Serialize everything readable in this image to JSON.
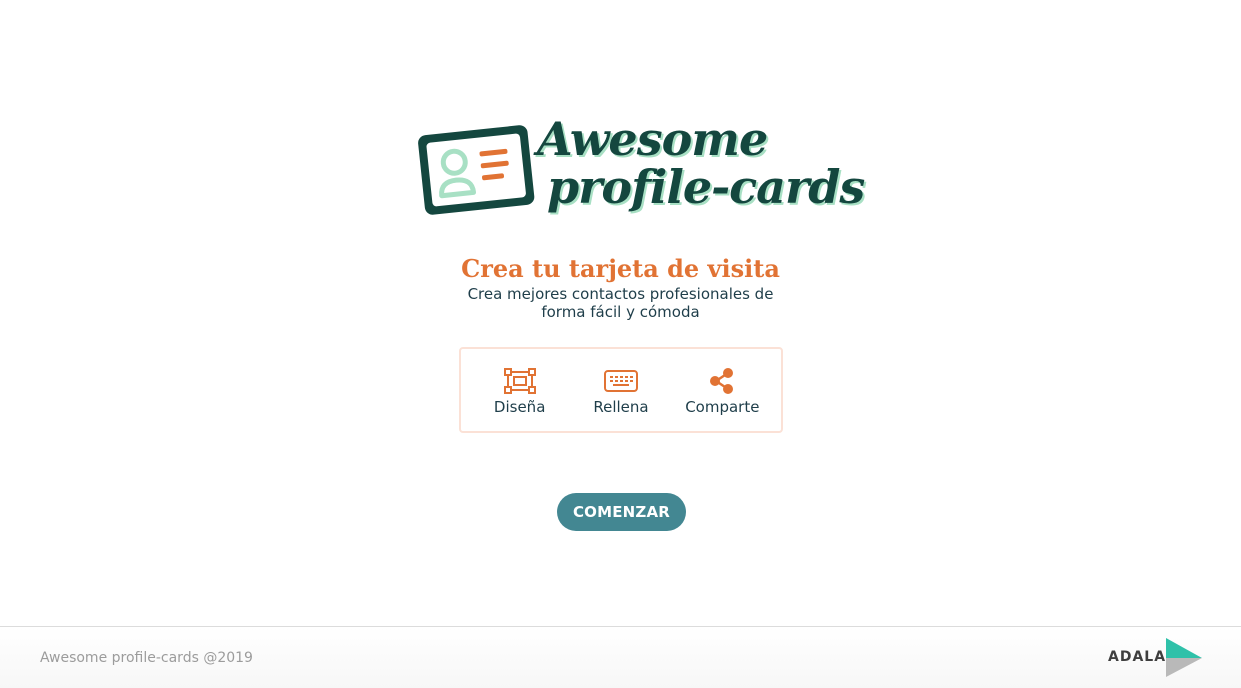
{
  "header": {
    "logo_line1": "Awesome",
    "logo_line2": "profile-cards"
  },
  "hero": {
    "title": "Crea tu tarjeta de visita",
    "subtitle": "Crea mejores contactos profesionales de forma fácil y cómoda"
  },
  "steps": [
    {
      "label": "Diseña",
      "icon": "design-icon"
    },
    {
      "label": "Rellena",
      "icon": "keyboard-icon"
    },
    {
      "label": "Comparte",
      "icon": "share-icon"
    }
  ],
  "cta": {
    "label": "COMENZAR"
  },
  "footer": {
    "copyright": "Awesome profile-cards @2019",
    "brand": "ADALAB"
  },
  "colors": {
    "brand_dark": "#14473f",
    "accent": "#e17334",
    "button": "#438792",
    "mint": "#a8e0c4"
  }
}
